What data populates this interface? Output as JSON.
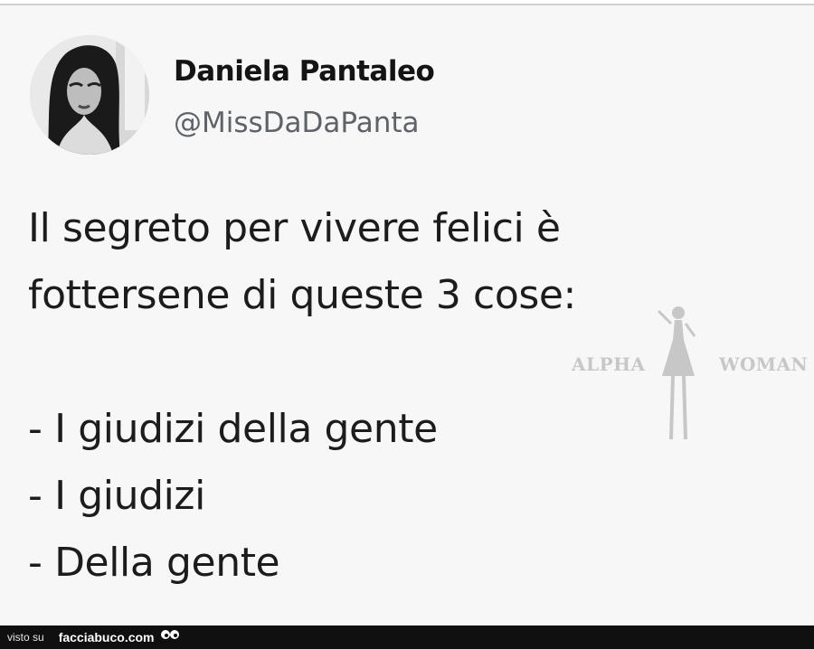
{
  "tweet": {
    "display_name": "Daniela Pantaleo",
    "handle": "@MissDaDaPanta",
    "text": "Il segreto per vivere felici è\nfottersene di queste 3 cose:\n\n- I giudizi della gente\n- I giudizi\n- Della gente"
  },
  "watermark": {
    "left_word": "ALPHA",
    "right_word": "WOMAN",
    "figure_icon": "woman-silhouette-icon"
  },
  "footer": {
    "prefix": "visto su",
    "site": "facciabuco.com",
    "logo_icon": "eyes-icon"
  },
  "colors": {
    "card_background": "#f7f7f7",
    "handle": "#5f6368",
    "watermark": "#c7c7c7",
    "footer_background": "#0f0f0f"
  }
}
